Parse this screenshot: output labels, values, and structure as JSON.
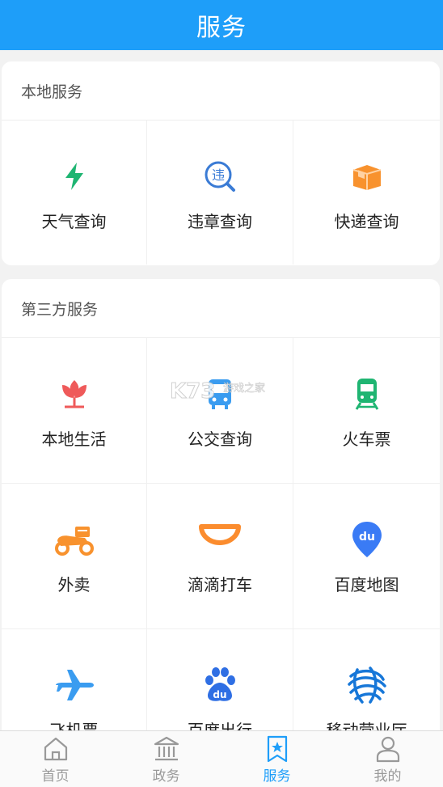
{
  "header": {
    "title": "服务"
  },
  "local_section": {
    "title": "本地服务",
    "items": [
      {
        "label": "天气查询",
        "icon": "lightning-icon",
        "color": "#1fb572"
      },
      {
        "label": "违章查询",
        "icon": "violation-search-icon",
        "color": "#3a7bd5",
        "icon_text": "违"
      },
      {
        "label": "快递查询",
        "icon": "package-icon",
        "color": "#f8922e"
      }
    ]
  },
  "third_party_section": {
    "title": "第三方服务",
    "items": [
      {
        "label": "本地生活",
        "icon": "tulip-icon",
        "color": "#ef5a5a"
      },
      {
        "label": "公交查询",
        "icon": "bus-icon",
        "color": "#3a9cf0"
      },
      {
        "label": "火车票",
        "icon": "train-icon",
        "color": "#1fb572"
      },
      {
        "label": "外卖",
        "icon": "scooter-icon",
        "color": "#f8922e"
      },
      {
        "label": "滴滴打车",
        "icon": "didi-icon",
        "color": "#fb8c2e"
      },
      {
        "label": "百度地图",
        "icon": "map-pin-icon",
        "color": "#3a7bf5",
        "icon_text": "du"
      },
      {
        "label": "飞机票",
        "icon": "airplane-icon",
        "color": "#3a9cf0"
      },
      {
        "label": "百度出行",
        "icon": "baidu-paw-icon",
        "color": "#2f6fe4",
        "icon_text": "du"
      },
      {
        "label": "移动营业厅",
        "icon": "china-mobile-icon",
        "color": "#1777d8"
      }
    ]
  },
  "watermark": {
    "text": "游戏之家",
    "logo": "K73"
  },
  "tabbar": {
    "active_color": "#1e9ef9",
    "inactive_color": "#999999",
    "items": [
      {
        "label": "首页",
        "icon": "home-icon"
      },
      {
        "label": "政务",
        "icon": "government-building-icon"
      },
      {
        "label": "服务",
        "icon": "service-star-icon",
        "active": true
      },
      {
        "label": "我的",
        "icon": "user-icon"
      }
    ]
  }
}
